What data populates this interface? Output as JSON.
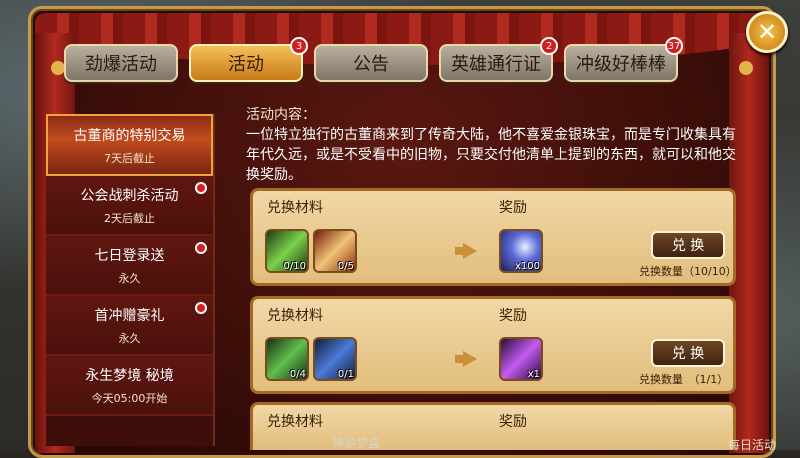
{
  "tabs": [
    {
      "label": "劲爆活动",
      "badge": ""
    },
    {
      "label": "活动",
      "badge": "3"
    },
    {
      "label": "公告",
      "badge": ""
    },
    {
      "label": "英雄通行证",
      "badge": "2"
    },
    {
      "label": "冲级好棒棒",
      "badge": "37"
    }
  ],
  "close_label": "✕",
  "sidebar": {
    "items": [
      {
        "title": "古董商的特别交易",
        "sub": "7天后截止"
      },
      {
        "title": "公会战刺杀活动",
        "sub": "2天后截止"
      },
      {
        "title": "七日登录送",
        "sub": "永久"
      },
      {
        "title": "首冲赠豪礼",
        "sub": "永久"
      },
      {
        "title": "永生梦境 秘境",
        "sub": "今天05:00开始"
      }
    ]
  },
  "content": {
    "label": "活动内容：",
    "description": "一位特立独行的古董商来到了传奇大陆，他不喜爱金银珠宝，而是专门收集具有年代久远，或是不受看中的旧物，只要交付他清单上提到的东西，就可以和他交换奖励。"
  },
  "exchanges": [
    {
      "materials_label": "兑换材料",
      "reward_label": "奖励",
      "materials": [
        {
          "icon": "green-scroll-icon",
          "count": "0/10"
        },
        {
          "icon": "book-icon",
          "count": "0/5"
        }
      ],
      "reward": {
        "icon": "blue-crescent-icon",
        "count": "x100"
      },
      "button": "兑 换",
      "exchange_count": "兑换数量（10/10）"
    },
    {
      "materials_label": "兑换材料",
      "reward_label": "奖励",
      "materials": [
        {
          "icon": "green-card-icon",
          "count": "0/4"
        },
        {
          "icon": "blue-card-icon",
          "count": "0/1"
        }
      ],
      "reward": {
        "icon": "purple-card-icon",
        "count": "x1"
      },
      "button": "兑 换",
      "exchange_count": "兑换数量　（1/1）"
    },
    {
      "materials_label": "兑换材料",
      "reward_label": "奖励"
    }
  ],
  "bottom": {
    "left_hint": "神谕梦盒",
    "right_hint": "每日活动"
  }
}
